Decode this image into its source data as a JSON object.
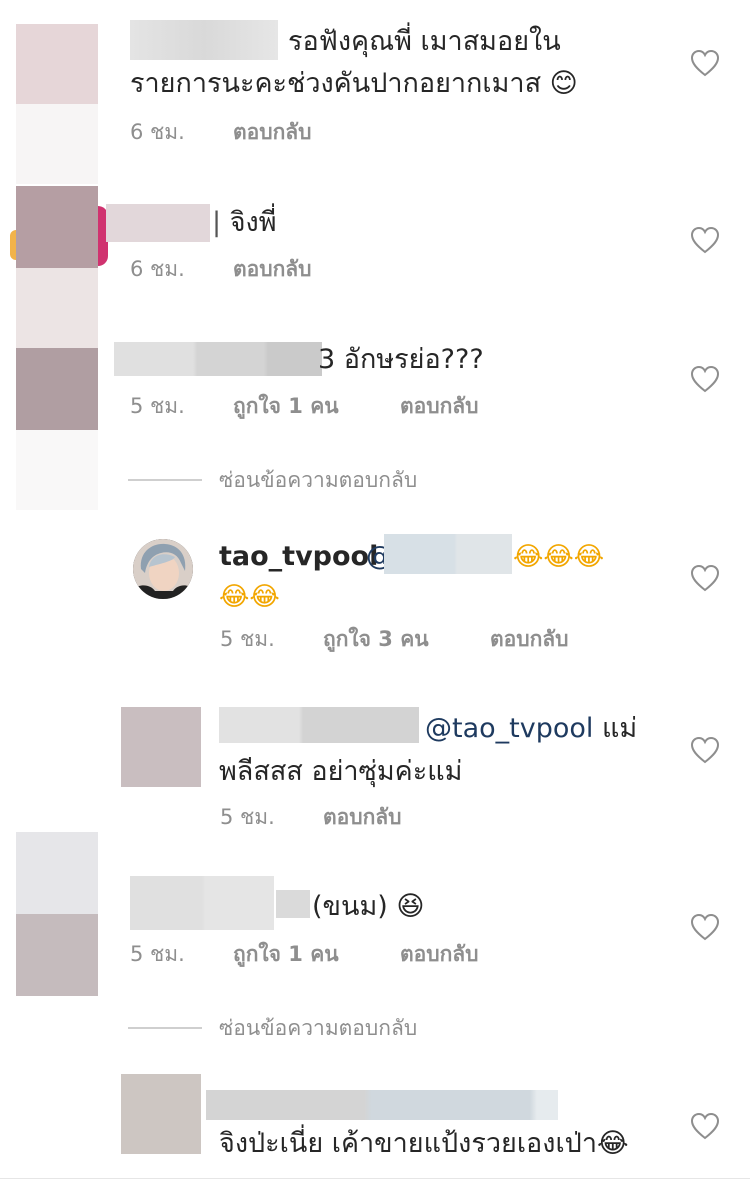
{
  "comments": [
    {
      "line1": "รอฟังคุณพี่ เมาสมอยใน",
      "line2": "รายการนะคะช่วงคันปากอยากเมาส 😊",
      "time": "6 ชม.",
      "reply": "ตอบกลับ"
    },
    {
      "text": "จิงพี่",
      "time": "6 ชม.",
      "reply": "ตอบกลับ"
    },
    {
      "text": "3 อักษรย่อ???",
      "time": "5 ชม.",
      "likes": "ถูกใจ 1 คน",
      "reply": "ตอบกลับ",
      "hide_replies": "ซ่อนข้อความตอบกลับ"
    },
    {
      "username": "tao_tvpool",
      "text": "@ 😂😂😂",
      "line2": "😂😂",
      "time": "5 ชม.",
      "likes": "ถูกใจ 3 คน",
      "reply": "ตอบกลับ"
    },
    {
      "mention": "@tao_tvpool",
      "line1_tail": "แม่",
      "line2": "พลีสสส อย่าซุ่มค่ะแม่",
      "time": "5 ชม.",
      "reply": "ตอบกลับ"
    },
    {
      "text": "(ขนม) 😆",
      "time": "5 ชม.",
      "likes": "ถูกใจ 1 คน",
      "reply": "ตอบกลับ",
      "hide_replies": "ซ่อนข้อความตอบกลับ"
    },
    {
      "text": "จิงป่ะเนี่ย เค้าขายแป้งรวยเองเป่า😂"
    }
  ],
  "icons": {
    "heart": "heart-icon"
  },
  "colors": {
    "meta": "#8e8e8e",
    "text": "#262626",
    "mention": "#1e3a5f"
  }
}
